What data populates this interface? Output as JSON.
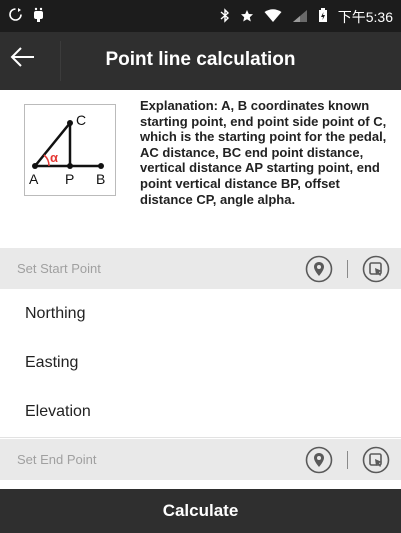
{
  "status_bar": {
    "left_icons": [
      "sync-icon",
      "android-debug-icon"
    ],
    "right_icons": [
      "bluetooth-icon",
      "star-icon",
      "wifi-icon",
      "signal-icon",
      "battery-icon"
    ],
    "time": "下午5:36"
  },
  "toolbar": {
    "title": "Point line calculation"
  },
  "diagram": {
    "point_a": "A",
    "point_p": "P",
    "point_b": "B",
    "point_c": "C",
    "angle": "α"
  },
  "explanation": "Explanation: A, B coordinates known starting point, end point side point of C, which is the starting point for the pedal, AC distance, BC end point distance, vertical distance AP starting point, end point vertical distance BP, offset distance CP, angle alpha.",
  "start_section": {
    "label": "Set Start Point"
  },
  "fields": [
    {
      "label": "Northing"
    },
    {
      "label": "Easting"
    },
    {
      "label": "Elevation"
    }
  ],
  "end_section": {
    "label": "Set End Point"
  },
  "calculate_label": "Calculate",
  "colors": {
    "toolbar": "#2f2f2f",
    "status": "#1c1c1c",
    "section": "#e9e9e9",
    "angle": "#e53935"
  }
}
